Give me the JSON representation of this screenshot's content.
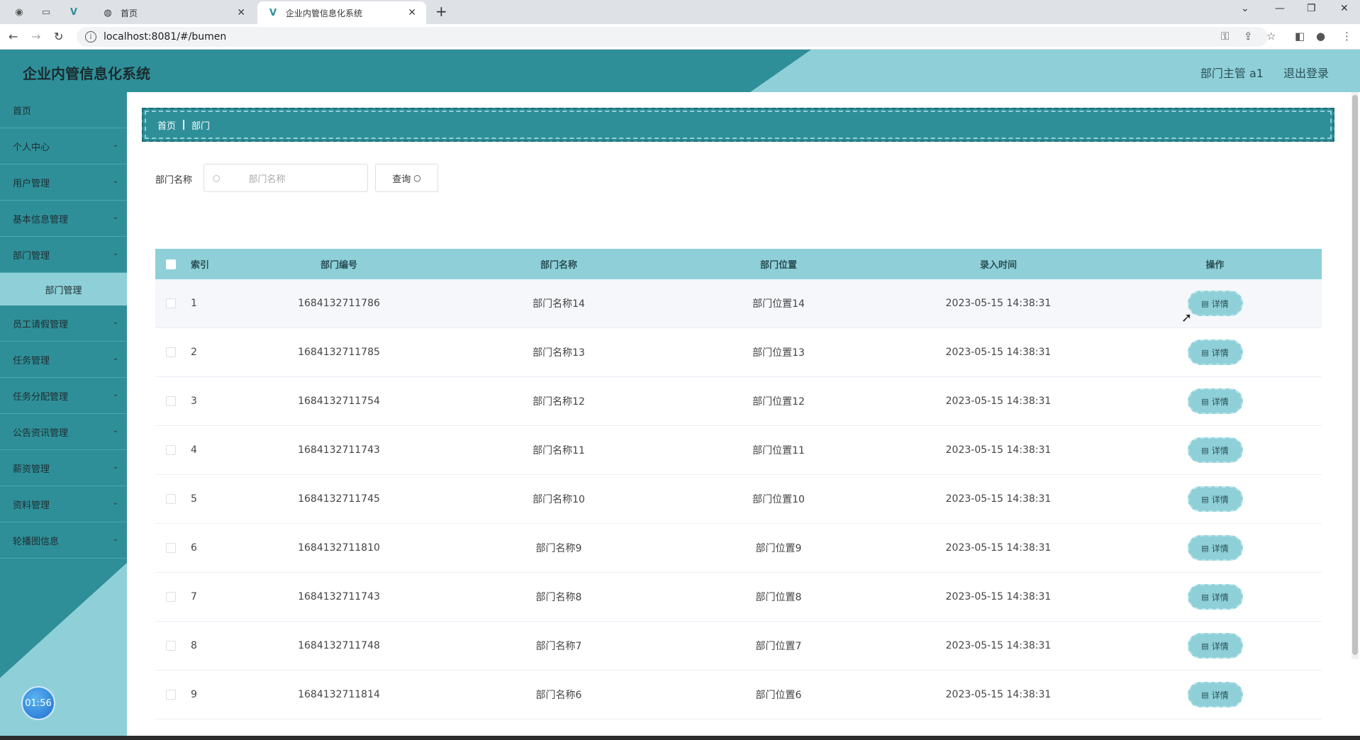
{
  "browser": {
    "tabs": [
      {
        "label": "首页",
        "active": false
      },
      {
        "label": "企业内管信息化系统",
        "active": true
      }
    ],
    "url": "localhost:8081/#/bumen"
  },
  "app": {
    "title": "企业内管信息化系统",
    "user_label": "部门主管 a1",
    "logout_label": "退出登录"
  },
  "sidebar": {
    "items": [
      {
        "label": "首页",
        "has_children": false
      },
      {
        "label": "个人中心",
        "has_children": true
      },
      {
        "label": "用户管理",
        "has_children": true
      },
      {
        "label": "基本信息管理",
        "has_children": true
      },
      {
        "label": "部门管理",
        "has_children": true,
        "expanded": true
      },
      {
        "label": "员工请假管理",
        "has_children": true
      },
      {
        "label": "任务管理",
        "has_children": true
      },
      {
        "label": "任务分配管理",
        "has_children": true
      },
      {
        "label": "公告资讯管理",
        "has_children": true
      },
      {
        "label": "薪资管理",
        "has_children": true
      },
      {
        "label": "资料管理",
        "has_children": true
      },
      {
        "label": "轮播图信息",
        "has_children": true
      }
    ],
    "submenu_active": "部门管理",
    "clock": "01:56"
  },
  "breadcrumb": [
    "首页",
    "部门"
  ],
  "search": {
    "label": "部门名称",
    "placeholder": "部门名称",
    "button_label": "查询"
  },
  "table": {
    "headers": [
      "索引",
      "部门编号",
      "部门名称",
      "部门位置",
      "录入时间",
      "操作"
    ],
    "detail_label": "详情",
    "rows": [
      {
        "idx": "1",
        "no": "1684132711786",
        "name": "部门名称14",
        "loc": "部门位置14",
        "time": "2023-05-15 14:38:31"
      },
      {
        "idx": "2",
        "no": "1684132711785",
        "name": "部门名称13",
        "loc": "部门位置13",
        "time": "2023-05-15 14:38:31"
      },
      {
        "idx": "3",
        "no": "1684132711754",
        "name": "部门名称12",
        "loc": "部门位置12",
        "time": "2023-05-15 14:38:31"
      },
      {
        "idx": "4",
        "no": "1684132711743",
        "name": "部门名称11",
        "loc": "部门位置11",
        "time": "2023-05-15 14:38:31"
      },
      {
        "idx": "5",
        "no": "1684132711745",
        "name": "部门名称10",
        "loc": "部门位置10",
        "time": "2023-05-15 14:38:31"
      },
      {
        "idx": "6",
        "no": "1684132711810",
        "name": "部门名称9",
        "loc": "部门位置9",
        "time": "2023-05-15 14:38:31"
      },
      {
        "idx": "7",
        "no": "1684132711743",
        "name": "部门名称8",
        "loc": "部门位置8",
        "time": "2023-05-15 14:38:31"
      },
      {
        "idx": "8",
        "no": "1684132711748",
        "name": "部门名称7",
        "loc": "部门位置7",
        "time": "2023-05-15 14:38:31"
      },
      {
        "idx": "9",
        "no": "1684132711814",
        "name": "部门名称6",
        "loc": "部门位置6",
        "time": "2023-05-15 14:38:31"
      }
    ]
  },
  "colors": {
    "primary": "#2f8f99",
    "light": "#8fd0d8"
  }
}
